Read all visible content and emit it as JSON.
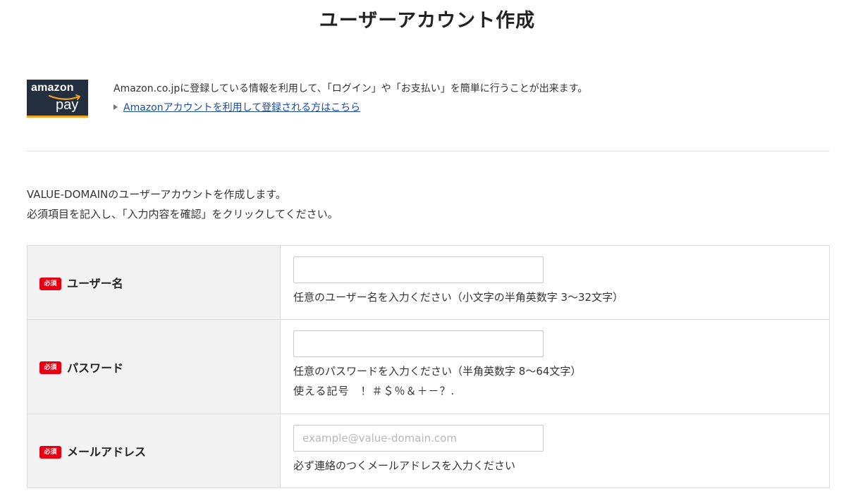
{
  "header": {
    "title": "ユーザーアカウント作成"
  },
  "amazon_pay": {
    "logo_word": "amazon",
    "logo_pay": "pay",
    "description": "Amazon.co.jpに登録している情報を利用して、「ログイン」や「お支払い」を簡単に行うことが出来ます。",
    "link_label": "Amazonアカウントを利用して登録される方はこちら"
  },
  "intro": {
    "line1": "VALUE-DOMAINのユーザーアカウントを作成します。",
    "line2": "必須項目を記入し、「入力内容を確認」をクリックしてください。"
  },
  "form": {
    "required_badge": "必須",
    "username": {
      "label": "ユーザー名",
      "value": "",
      "placeholder": "",
      "hint": "任意のユーザー名を入力ください（小文字の半角英数字 3〜32文字）"
    },
    "password": {
      "label": "パスワード",
      "value": "",
      "placeholder": "",
      "hint": "任意のパスワードを入力ください（半角英数字 8〜64文字）",
      "hint2": "使える記号　！＃＄％＆＋－？."
    },
    "email": {
      "label": "メールアドレス",
      "value": "",
      "placeholder": "example@value-domain.com",
      "hint": "必ず連絡のつくメールアドレスを入力ください"
    }
  },
  "colors": {
    "required_badge": "#e60012",
    "link": "#1a4ba8",
    "amazon_bg": "#232f3e",
    "amazon_accent": "#f4a224",
    "label_bg": "#f2f2f2"
  }
}
